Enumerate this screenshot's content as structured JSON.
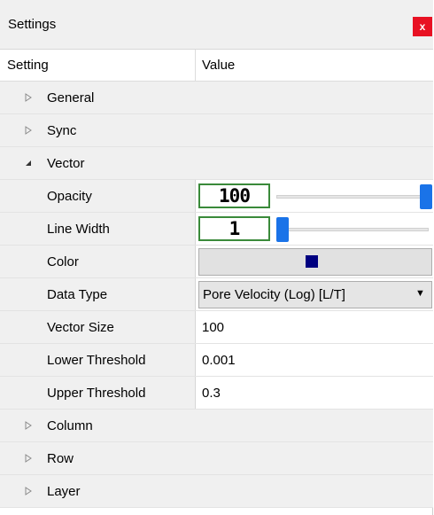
{
  "window": {
    "title": "Settings",
    "close_label": "x"
  },
  "header": {
    "setting": "Setting",
    "value": "Value"
  },
  "categories": {
    "general": {
      "label": "General",
      "expanded": false
    },
    "sync": {
      "label": "Sync",
      "expanded": false
    },
    "vector": {
      "label": "Vector",
      "expanded": true
    },
    "column": {
      "label": "Column",
      "expanded": false
    },
    "row": {
      "label": "Row",
      "expanded": false
    },
    "layer": {
      "label": "Layer",
      "expanded": false
    }
  },
  "vector": {
    "opacity": {
      "label": "Opacity",
      "value": "100",
      "slider_fraction": 1.0
    },
    "line_width": {
      "label": "Line Width",
      "value": "1",
      "slider_fraction": 0.0
    },
    "color": {
      "label": "Color",
      "swatch": "#000080"
    },
    "data_type": {
      "label": "Data Type",
      "value": "Pore Velocity (Log) [L/T]"
    },
    "vector_size": {
      "label": "Vector Size",
      "value": "100"
    },
    "lower_threshold": {
      "label": "Lower Threshold",
      "value": "0.001"
    },
    "upper_threshold": {
      "label": "Upper Threshold",
      "value": "0.3"
    }
  },
  "icons": {
    "collapsed": "triangle-right-icon",
    "expanded": "triangle-down-icon",
    "dropdown": "dropdown-arrow-icon"
  },
  "colors": {
    "close": "#e81123",
    "accent": "#1a73e8",
    "field_border": "#3a8a3a"
  }
}
